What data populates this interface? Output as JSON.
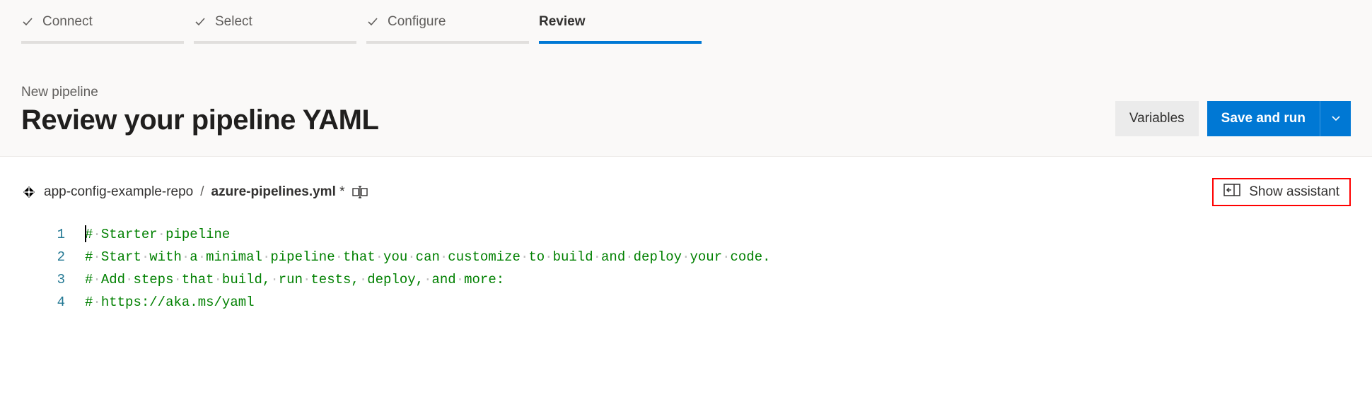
{
  "stepper": {
    "steps": [
      {
        "label": "Connect",
        "done": true
      },
      {
        "label": "Select",
        "done": true
      },
      {
        "label": "Configure",
        "done": true
      },
      {
        "label": "Review",
        "active": true
      }
    ]
  },
  "header": {
    "subtitle": "New pipeline",
    "title": "Review your pipeline YAML",
    "variables_label": "Variables",
    "save_and_run_label": "Save and run"
  },
  "breadcrumb": {
    "repo": "app-config-example-repo",
    "separator": "/",
    "filename": "azure-pipelines.yml",
    "dirty_marker": "*"
  },
  "assistant": {
    "label": "Show assistant"
  },
  "editor": {
    "lines": [
      {
        "n": "1",
        "type": "comment",
        "text": "# Starter pipeline"
      },
      {
        "n": "2",
        "type": "comment",
        "text": "# Start with a minimal pipeline that you can customize to build and deploy your code."
      },
      {
        "n": "3",
        "type": "comment",
        "text": "# Add steps that build, run tests, deploy, and more:"
      },
      {
        "n": "4",
        "type": "comment",
        "text": "# https://aka.ms/yaml"
      }
    ]
  },
  "colors": {
    "primary": "#0078d4",
    "comment": "#008000",
    "highlight_border": "#ff0000"
  }
}
